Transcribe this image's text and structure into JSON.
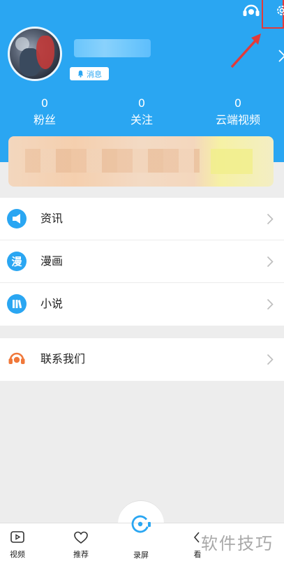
{
  "header": {
    "message_badge": "消息",
    "colors": {
      "header_bg": "#2aa6f2",
      "highlight_box": "#e23a3a"
    },
    "icons": [
      "customer-service-icon",
      "settings-icon",
      "bell-icon",
      "chevron-right-icon"
    ]
  },
  "stats": [
    {
      "value": "0",
      "label": "粉丝"
    },
    {
      "value": "0",
      "label": "关注"
    },
    {
      "value": "0",
      "label": "云端视频"
    }
  ],
  "menu": {
    "group1": [
      {
        "label": "资讯",
        "icon": "megaphone-icon"
      },
      {
        "label": "漫画",
        "icon": "comic-icon",
        "icon_text": "漫"
      },
      {
        "label": "小说",
        "icon": "books-icon"
      }
    ],
    "group2": [
      {
        "label": "联系我们",
        "icon": "headset-icon"
      }
    ]
  },
  "bottom_nav": [
    {
      "label": "视频",
      "icon": "video-icon"
    },
    {
      "label": "推荐",
      "icon": "heart-icon"
    },
    {
      "label": "录屏",
      "icon": "camera-icon"
    },
    {
      "label": "看",
      "icon": "chevron-left-icon"
    }
  ],
  "watermark": "软件技巧"
}
